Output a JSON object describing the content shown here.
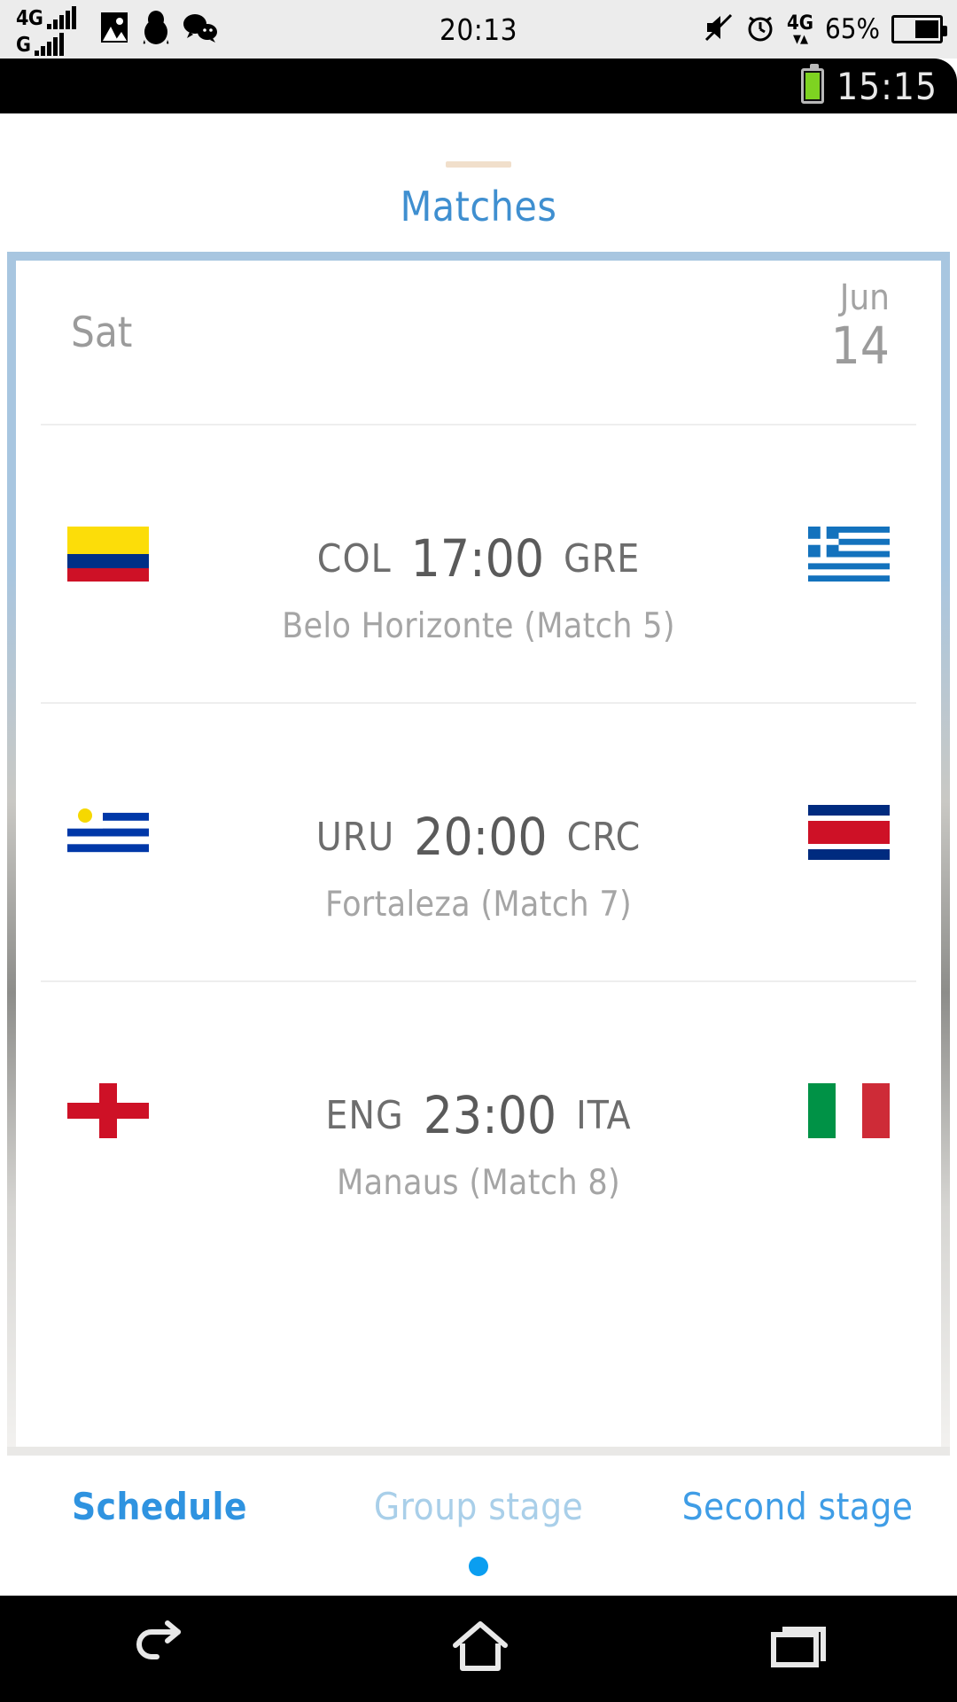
{
  "host_status": {
    "network_primary": "4G",
    "network_secondary": "G",
    "time": "20:13",
    "battery_percent": "65%",
    "network_right": "4G",
    "icons": [
      "photo-icon",
      "penguin-icon",
      "wechat-icon",
      "mute-icon",
      "alarm-icon",
      "data-transfer-icon",
      "battery-icon"
    ]
  },
  "inner_status": {
    "time": "15:15",
    "battery_icon": "battery-icon",
    "battery_color": "#7ed321"
  },
  "app": {
    "title": "Matches",
    "title_color": "#3f8fd0",
    "date_header": {
      "day": "Sat",
      "month": "Jun",
      "date": "14"
    },
    "matches": [
      {
        "home_code": "COL",
        "away_code": "GRE",
        "kickoff": "17:00",
        "venue": "Belo Horizonte (Match  5)",
        "home_flag": "colombia-flag",
        "away_flag": "greece-flag"
      },
      {
        "home_code": "URU",
        "away_code": "CRC",
        "kickoff": "20:00",
        "venue": "Fortaleza (Match  7)",
        "home_flag": "uruguay-flag",
        "away_flag": "costa-rica-flag"
      },
      {
        "home_code": "ENG",
        "away_code": "ITA",
        "kickoff": "23:00",
        "venue": "Manaus (Match  8)",
        "home_flag": "england-flag",
        "away_flag": "italy-flag"
      }
    ],
    "tabs": [
      {
        "label": "Schedule",
        "state": "active"
      },
      {
        "label": "Group stage",
        "state": "muted"
      },
      {
        "label": "Second stage",
        "state": "normal"
      }
    ],
    "page_indicator_color": "#0b9ef0"
  },
  "navbar": {
    "back": "back-icon",
    "home": "home-icon",
    "recents": "recents-icon"
  }
}
